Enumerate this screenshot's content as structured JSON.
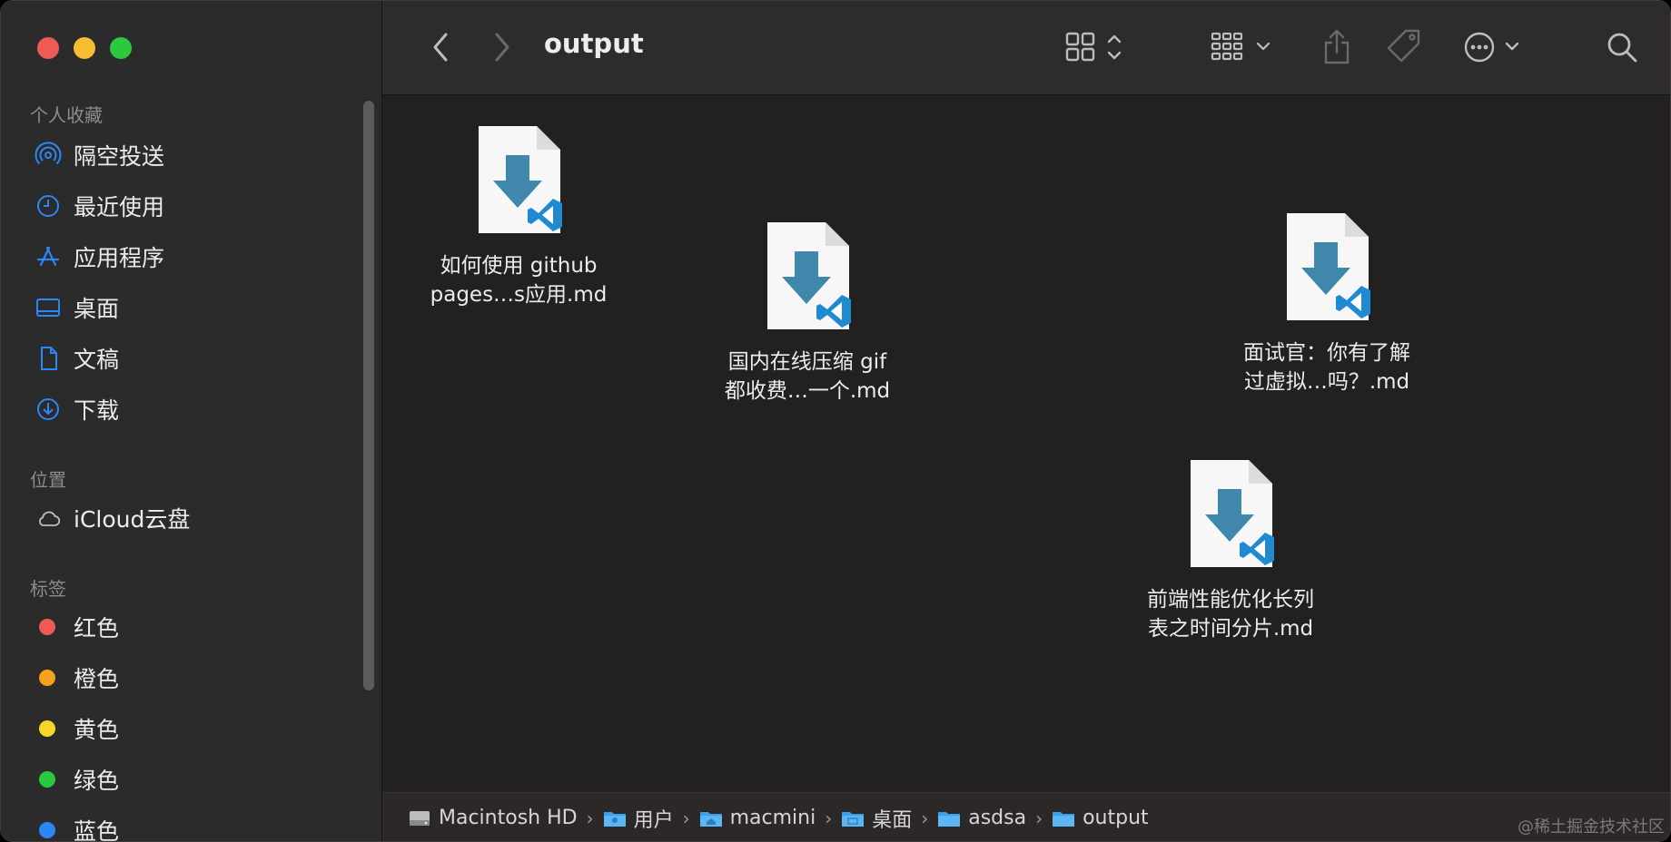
{
  "window": {
    "title": "output"
  },
  "sidebar": {
    "favorites_title": "个人收藏",
    "favorites": [
      {
        "label": "隔空投送",
        "icon": "airdrop-icon"
      },
      {
        "label": "最近使用",
        "icon": "clock-icon"
      },
      {
        "label": "应用程序",
        "icon": "applications-icon"
      },
      {
        "label": "桌面",
        "icon": "desktop-icon"
      },
      {
        "label": "文稿",
        "icon": "document-icon"
      },
      {
        "label": "下载",
        "icon": "download-icon"
      }
    ],
    "locations_title": "位置",
    "locations": [
      {
        "label": "iCloud云盘",
        "icon": "cloud-icon"
      }
    ],
    "tags_title": "标签",
    "tags": [
      {
        "label": "红色",
        "color": "#ee5b53"
      },
      {
        "label": "橙色",
        "color": "#f6a11c"
      },
      {
        "label": "黄色",
        "color": "#f7d62a"
      },
      {
        "label": "绿色",
        "color": "#2bc840"
      },
      {
        "label": "蓝色",
        "color": "#2b86f6"
      }
    ]
  },
  "files": [
    {
      "name": "如何使用 github\npages…s应用.md"
    },
    {
      "name": "国内在线压缩 gif\n都收费…一个.md"
    },
    {
      "name": "面试官：你有了解\n过虚拟…吗？.md"
    },
    {
      "name": "前端性能优化长列\n表之时间分片.md"
    }
  ],
  "pathbar": {
    "items": [
      {
        "label": "Macintosh HD",
        "icon": "hard-drive-icon"
      },
      {
        "label": "用户",
        "icon": "folder-users-icon"
      },
      {
        "label": "macmini",
        "icon": "folder-home-icon"
      },
      {
        "label": "桌面",
        "icon": "folder-desktop-icon"
      },
      {
        "label": "asdsa",
        "icon": "folder-icon"
      },
      {
        "label": "output",
        "icon": "folder-icon"
      }
    ],
    "separator": "›"
  },
  "watermark": "@稀土掘金技术社区",
  "colors": {
    "accent": "#2b86f6",
    "vscode_blue": "#1f8ad2",
    "download_arrow": "#3f87ab"
  }
}
